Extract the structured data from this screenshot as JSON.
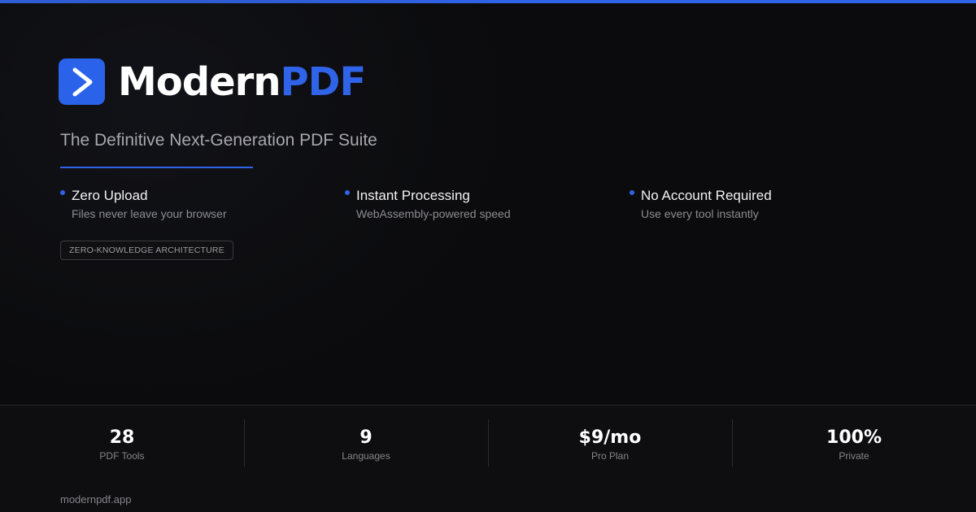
{
  "brand": {
    "name_primary": "Modern",
    "name_accent": "PDF",
    "logo_icon": "play-chevron-icon",
    "accent_color": "#2f63e8"
  },
  "tagline": "The Definitive Next-Generation PDF Suite",
  "features": [
    {
      "title": "Zero Upload",
      "description": "Files never leave your browser"
    },
    {
      "title": "Instant Processing",
      "description": "WebAssembly-powered speed"
    },
    {
      "title": "No Account Required",
      "description": "Use every tool instantly"
    }
  ],
  "badge": "ZERO-KNOWLEDGE ARCHITECTURE",
  "stats": [
    {
      "value": "28",
      "label": "PDF Tools"
    },
    {
      "value": "9",
      "label": "Languages"
    },
    {
      "value": "$9/mo",
      "label": "Pro Plan"
    },
    {
      "value": "100%",
      "label": "Private"
    }
  ],
  "footer": {
    "domain": "modernpdf.app"
  }
}
